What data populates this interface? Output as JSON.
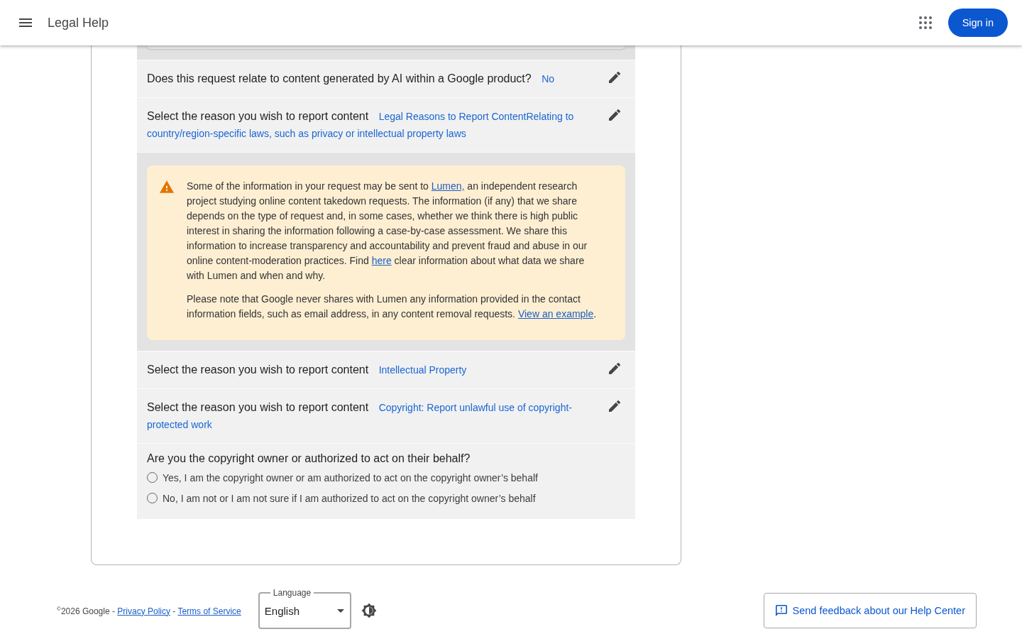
{
  "header": {
    "title": "Legal Help",
    "sign_in": "Sign in"
  },
  "sections": [
    {
      "kind": "answered",
      "question": "Does this request relate to content generated by AI within a Google product?",
      "answer": "No"
    },
    {
      "kind": "answered",
      "question": "Select the reason you wish to report content",
      "answer": "Legal Reasons to Report ContentRelating to country/region-specific laws, such as privacy or intellectual property laws"
    },
    {
      "kind": "notice",
      "paragraphs": [
        {
          "segments": [
            {
              "kind": "text",
              "text": "Some of the information in your request may be sent to "
            },
            {
              "kind": "link",
              "text": "Lumen,"
            },
            {
              "kind": "text",
              "text": " an independent research project studying online content takedown requests. The information (if any) that we share depends on the type of request and, in some cases, whether we think there is high public interest in sharing the information following a case-by-case assessment. We share this information to increase transparency and accountability and prevent fraud and abuse in our online content-moderation practices. Find "
            },
            {
              "kind": "link",
              "text": "here"
            },
            {
              "kind": "text",
              "text": " clear information about what data we share with Lumen and when and why."
            }
          ]
        },
        {
          "segments": [
            {
              "kind": "text",
              "text": "Please note that Google never shares with Lumen any information provided in the contact information fields, such as email address, in any content removal requests. "
            },
            {
              "kind": "link",
              "text": "View an example"
            },
            {
              "kind": "text",
              "text": "."
            }
          ]
        }
      ]
    },
    {
      "kind": "answered",
      "question": "Select the reason you wish to report content",
      "answer": "Intellectual Property"
    },
    {
      "kind": "answered",
      "question": "Select the reason you wish to report content",
      "answer": "Copyright: Report unlawful use of copyright-protected work"
    },
    {
      "kind": "choice",
      "question": "Are you the copyright owner or authorized to act on their behalf?",
      "options": [
        {
          "label": "Yes, I am the copyright owner or am authorized to act on the copyright owner’s behalf",
          "selected": false
        },
        {
          "label": "No, I am not or I am not sure if I am authorized to act on the copyright owner’s behalf",
          "selected": false
        }
      ]
    }
  ],
  "footer": {
    "legal": [
      {
        "kind": "text",
        "text": "$^{©}$2026 Google - "
      },
      {
        "kind": "link",
        "text": "Privacy Policy"
      },
      {
        "kind": "text",
        "text": " - "
      },
      {
        "kind": "link",
        "text": "Terms of Service"
      }
    ],
    "language": {
      "label": "Language",
      "value": "English"
    },
    "feedback": "Send feedback about our Help Center"
  }
}
